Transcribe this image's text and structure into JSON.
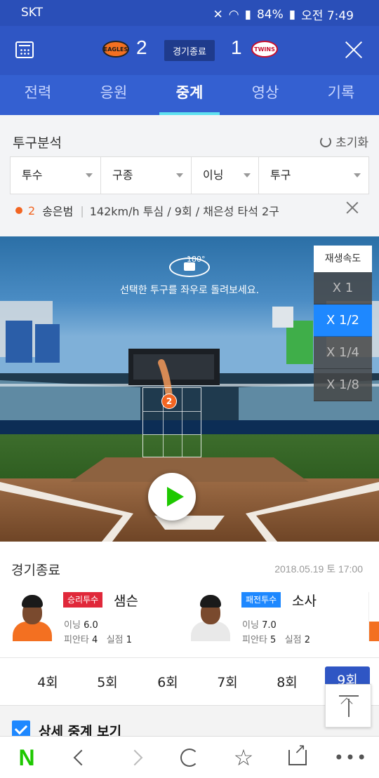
{
  "status_bar": {
    "carrier": "SKT",
    "battery": "84%",
    "time": "오전 7:49"
  },
  "game": {
    "home_score": "2",
    "away_score": "1",
    "status": "경기종료",
    "home_logo_text": "EAGLES",
    "away_logo_text": "TWINS"
  },
  "tabs": [
    {
      "label": "전력"
    },
    {
      "label": "응원"
    },
    {
      "label": "중계"
    },
    {
      "label": "영상"
    },
    {
      "label": "기록"
    }
  ],
  "analysis": {
    "title": "투구분석",
    "reset_label": "초기화",
    "filters": [
      {
        "label": "투수"
      },
      {
        "label": "구종"
      },
      {
        "label": "이닝"
      },
      {
        "label": "투구"
      }
    ],
    "pitch_number": "2",
    "pitcher_name": "송은범",
    "pitch_description": "142km/h 투심 / 9회 / 채은성 타석 2구"
  },
  "viewer": {
    "rotate_degree": "180°",
    "rotate_hint": "선택한 투구를 좌우로 돌려보세요.",
    "marker_number": "2",
    "speed_title": "재생속도",
    "speed_options": [
      {
        "label": "X 1"
      },
      {
        "label": "X 1/2"
      },
      {
        "label": "X 1/4"
      },
      {
        "label": "X 1/8"
      }
    ],
    "selected_speed": "X 1/2"
  },
  "result": {
    "title": "경기종료",
    "date": "2018.05.19 토 17:00",
    "win": {
      "badge": "승리투수",
      "name": "샘슨",
      "innings_label": "이닝",
      "innings": "6.0",
      "hits_label": "피안타",
      "hits": "4",
      "runs_label": "실점",
      "runs": "1"
    },
    "lose": {
      "badge": "패전투수",
      "name": "소사",
      "innings_label": "이닝",
      "innings": "7.0",
      "hits_label": "피안타",
      "hits": "5",
      "runs_label": "실점",
      "runs": "2"
    }
  },
  "innings": [
    {
      "label": "4회"
    },
    {
      "label": "5회"
    },
    {
      "label": "6회"
    },
    {
      "label": "7회"
    },
    {
      "label": "8회"
    },
    {
      "label": "9회"
    }
  ],
  "detail": {
    "label": "상세 중계 보기",
    "checked": true
  },
  "bottom_nav": {
    "logo": "N",
    "more": "•••"
  },
  "colors": {
    "brand_blue": "#2f56c4",
    "naver_green": "#1ec800",
    "accent_orange": "#f26522",
    "speed_selected": "#1e88ff"
  }
}
